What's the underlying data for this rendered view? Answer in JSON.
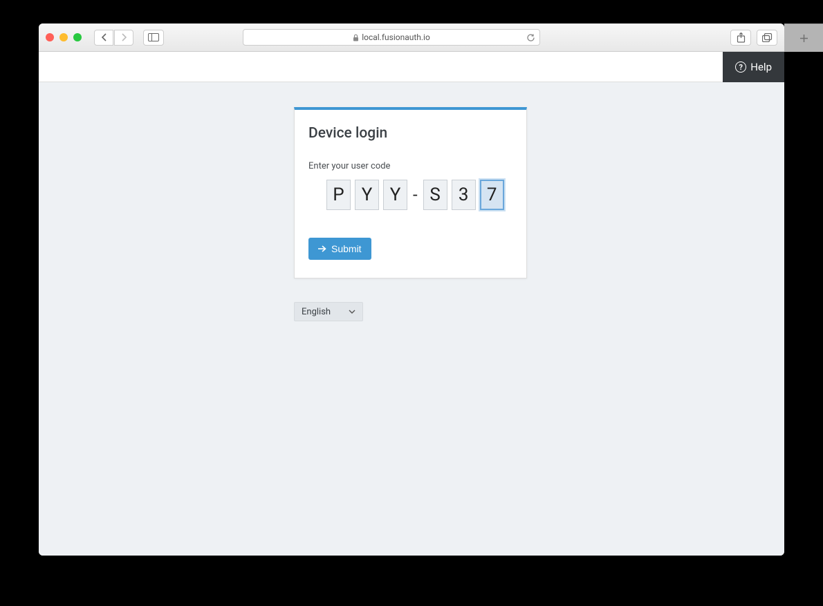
{
  "browser": {
    "url": "local.fusionauth.io"
  },
  "header": {
    "help_label": "Help"
  },
  "card": {
    "title": "Device login",
    "field_label": "Enter your user code",
    "code": [
      "P",
      "Y",
      "Y",
      "S",
      "3",
      "7"
    ],
    "separator": "-",
    "submit_label": "Submit"
  },
  "language": {
    "selected": "English"
  }
}
